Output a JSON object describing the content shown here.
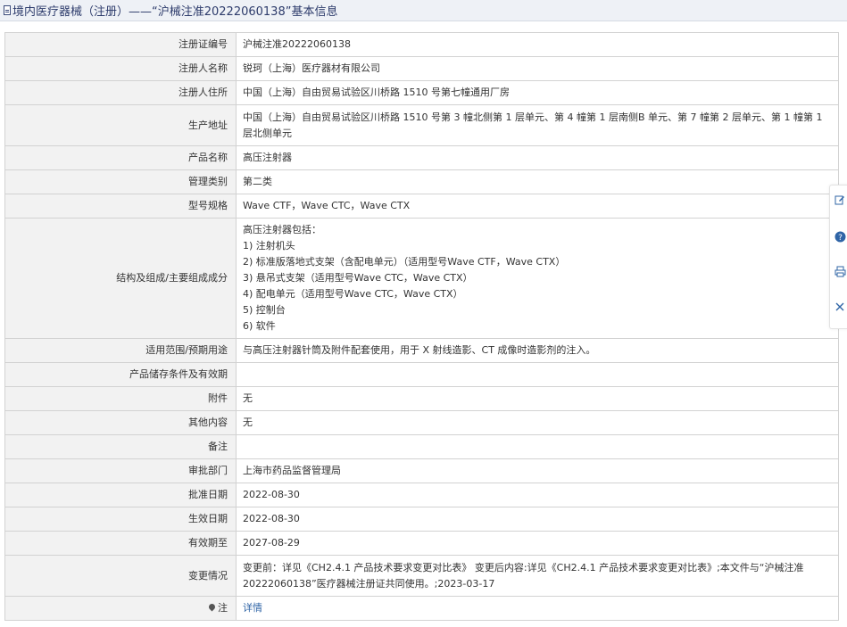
{
  "header": {
    "title": "境内医疗器械（注册）——“沪械注准20222060138”基本信息"
  },
  "rows": [
    {
      "label": "注册证编号",
      "value": "沪械注准20222060138"
    },
    {
      "label": "注册人名称",
      "value": "锐珂（上海）医疗器材有限公司"
    },
    {
      "label": "注册人住所",
      "value": "中国（上海）自由贸易试验区川桥路 1510 号第七幢通用厂房"
    },
    {
      "label": "生产地址",
      "value": "中国（上海）自由贸易试验区川桥路 1510 号第 3 幢北侧第 1 层单元、第 4 幢第 1 层南侧B 单元、第 7 幢第 2 层单元、第 1 幢第 1 层北侧单元"
    },
    {
      "label": "产品名称",
      "value": "高压注射器"
    },
    {
      "label": "管理类别",
      "value": "第二类"
    },
    {
      "label": "型号规格",
      "value": "Wave CTF，Wave CTC，Wave CTX"
    },
    {
      "label": "结构及组成/主要组成成分",
      "lines": [
        "高压注射器包括：",
        "1) 注射机头",
        "2) 标准版落地式支架（含配电单元）（适用型号Wave CTF，Wave CTX）",
        "3) 悬吊式支架（适用型号Wave CTC，Wave CTX）",
        "4) 配电单元（适用型号Wave CTC，Wave CTX）",
        "5) 控制台",
        "6) 软件"
      ]
    },
    {
      "label": "适用范围/预期用途",
      "value": "与高压注射器针筒及附件配套使用，用于 X 射线造影、CT 成像时造影剂的注入。"
    },
    {
      "label": "产品储存条件及有效期",
      "value": ""
    },
    {
      "label": "附件",
      "value": "无"
    },
    {
      "label": "其他内容",
      "value": "无"
    },
    {
      "label": "备注",
      "value": ""
    },
    {
      "label": "审批部门",
      "value": "上海市药品监督管理局"
    },
    {
      "label": "批准日期",
      "value": "2022-08-30"
    },
    {
      "label": "生效日期",
      "value": "2022-08-30"
    },
    {
      "label": "有效期至",
      "value": "2027-08-29"
    },
    {
      "label": "变更情况",
      "value": "变更前：详见《CH2.4.1 产品技术要求变更对比表》 变更后内容:详见《CH2.4.1 产品技术要求变更对比表》;本文件与“沪械注准20222060138”医疗器械注册证共同使用。;2023-03-17"
    },
    {
      "label": "注",
      "link": "详情"
    }
  ],
  "side_toolbar": [
    "edit-icon",
    "help-icon",
    "print-icon",
    "close-icon"
  ]
}
